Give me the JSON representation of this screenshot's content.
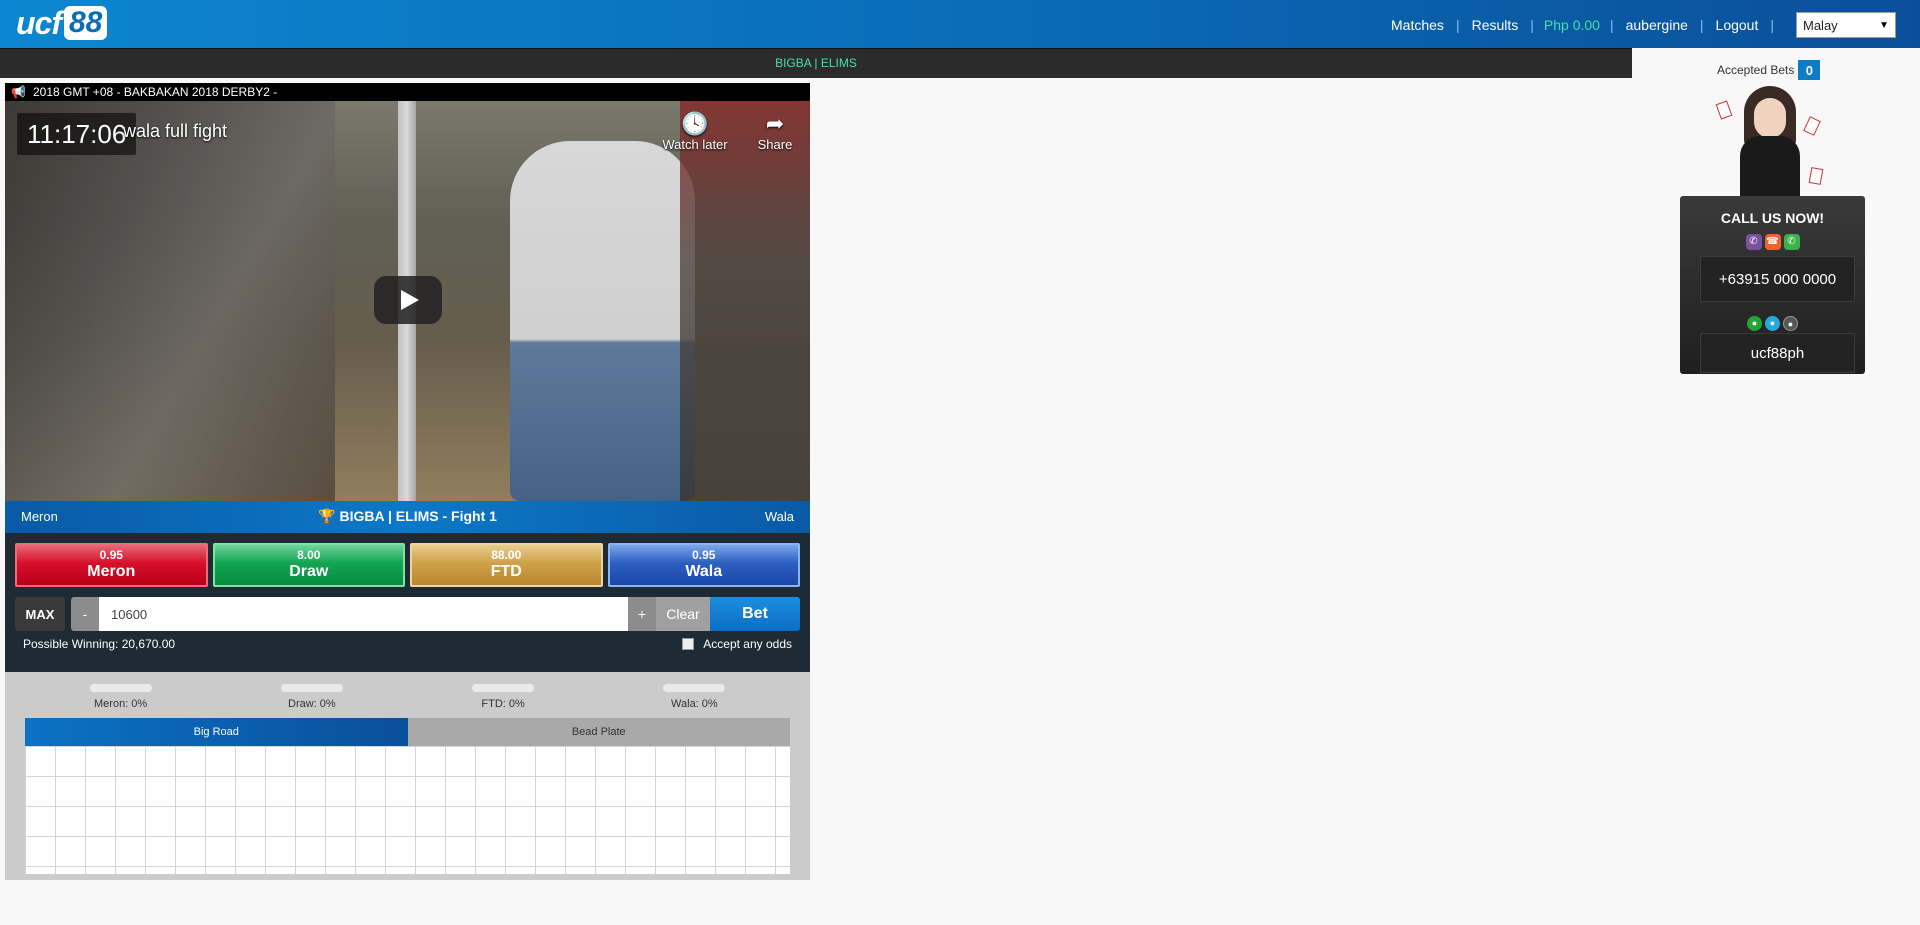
{
  "header": {
    "logo_text": "ucf",
    "logo_badge": "88",
    "nav": [
      {
        "label": "Matches"
      },
      {
        "label": "Results"
      }
    ],
    "balance": "Php 0.00",
    "username": "aubergine",
    "logout": "Logout",
    "language": "Malay"
  },
  "tournament_bar": "BIGBA | ELIMS",
  "video": {
    "title": "2018 GMT +08 - BAKBAKAN 2018 DERBY2 -",
    "clock": "11:17:06",
    "caption": "wala full fight",
    "watch_later": "Watch later",
    "share": "Share"
  },
  "fight": {
    "left": "Meron",
    "center": "BIGBA | ELIMS - Fight 1",
    "right": "Wala"
  },
  "odds": [
    {
      "value": "0.95",
      "name": "Meron"
    },
    {
      "value": "8.00",
      "name": "Draw"
    },
    {
      "value": "88.00",
      "name": "FTD"
    },
    {
      "value": "0.95",
      "name": "Wala"
    }
  ],
  "stake": {
    "max": "MAX",
    "minus": "-",
    "amount": "10600",
    "plus": "+",
    "clear": "Clear",
    "bet": "Bet",
    "possible_winning": "Possible Winning: 20,670.00",
    "accept_any_odds": "Accept any odds"
  },
  "stats": {
    "percentages": [
      {
        "label": "Meron: 0%"
      },
      {
        "label": "Draw: 0%"
      },
      {
        "label": "FTD: 0%"
      },
      {
        "label": "Wala: 0%"
      }
    ],
    "tabs": [
      {
        "label": "Big Road",
        "active": true
      },
      {
        "label": "Bead Plate",
        "active": false
      }
    ]
  },
  "sidebar": {
    "accepted_bets_label": "Accepted Bets",
    "accepted_bets_count": "0",
    "call_title": "CALL US NOW!",
    "phone": "+63915 000 0000",
    "chat_id": "ucf88ph"
  },
  "colors": {
    "header_blue": "#0a6db8",
    "accent_green": "#46e0ab",
    "meron_red": "#d8102a",
    "draw_green": "#11a552",
    "ftd_gold": "#cfa24a",
    "wala_blue": "#2d5fc2"
  }
}
